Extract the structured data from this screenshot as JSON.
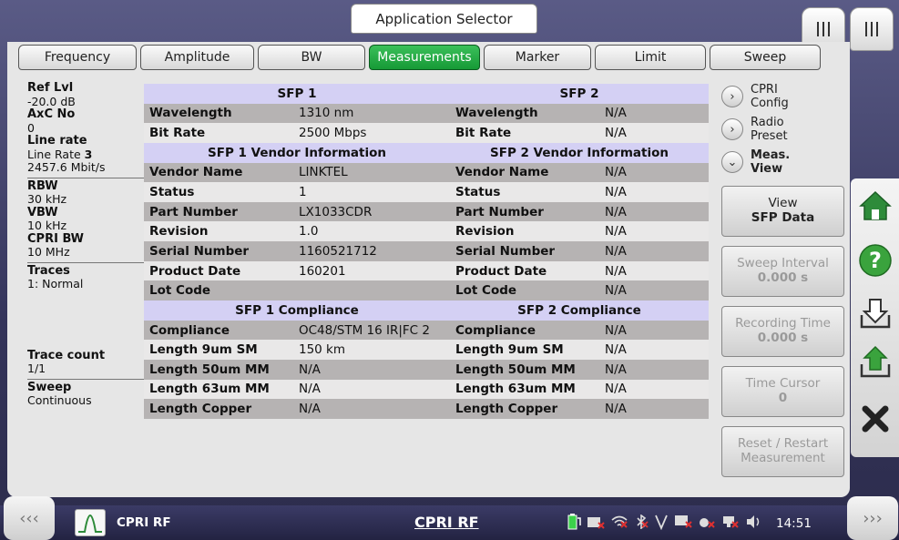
{
  "window": {
    "title": "Application Selector"
  },
  "tabs": [
    {
      "label": "Frequency",
      "active": false
    },
    {
      "label": "Amplitude",
      "active": false
    },
    {
      "label": "BW",
      "active": false
    },
    {
      "label": "Measurements",
      "active": true
    },
    {
      "label": "Marker",
      "active": false
    },
    {
      "label": "Limit",
      "active": false
    },
    {
      "label": "Sweep",
      "active": false
    }
  ],
  "info": {
    "ref_lvl_label": "Ref Lvl",
    "ref_lvl_value": "-20.0 dB",
    "axc_label": "AxC No",
    "axc_value": "0",
    "line_rate_label": "Line rate",
    "line_rate_prefix": "Line Rate ",
    "line_rate_num": "3",
    "line_rate_speed": "2457.6 Mbit/s",
    "rbw_label": "RBW",
    "rbw_value": "30 kHz",
    "vbw_label": "VBW",
    "vbw_value": "10 kHz",
    "cpri_bw_label": "CPRI BW",
    "cpri_bw_value": "10 MHz",
    "traces_label": "Traces",
    "traces_value": "1: Normal",
    "trace_count_label": "Trace count",
    "trace_count_value": "1/1",
    "sweep_label": "Sweep",
    "sweep_value": "Continuous"
  },
  "table": {
    "header1": {
      "sfp1": "SFP 1",
      "sfp2": "SFP 2"
    },
    "rows1": [
      {
        "label": "Wavelength",
        "v1": "1310 nm",
        "label2": "Wavelength",
        "v2": "N/A"
      },
      {
        "label": "Bit Rate",
        "v1": "2500 Mbps",
        "label2": "Bit Rate",
        "v2": "N/A"
      }
    ],
    "header2": {
      "sfp1": "SFP 1 Vendor Information",
      "sfp2": "SFP 2 Vendor Information"
    },
    "rows2": [
      {
        "label": "Vendor Name",
        "v1": "LINKTEL",
        "label2": "Vendor Name",
        "v2": "N/A"
      },
      {
        "label": "Status",
        "v1": "1",
        "label2": "Status",
        "v2": "N/A"
      },
      {
        "label": "Part Number",
        "v1": "LX1033CDR",
        "label2": "Part Number",
        "v2": "N/A"
      },
      {
        "label": "Revision",
        "v1": "1.0",
        "label2": "Revision",
        "v2": "N/A"
      },
      {
        "label": "Serial Number",
        "v1": "1160521712",
        "label2": "Serial Number",
        "v2": "N/A"
      },
      {
        "label": "Product Date",
        "v1": "160201",
        "label2": "Product Date",
        "v2": "N/A"
      },
      {
        "label": "Lot Code",
        "v1": "",
        "label2": "Lot Code",
        "v2": "N/A"
      }
    ],
    "header3": {
      "sfp1": "SFP 1 Compliance",
      "sfp2": "SFP 2 Compliance"
    },
    "rows3": [
      {
        "label": "Compliance",
        "v1": "OC48/STM 16 IR|FC 2",
        "label2": "Compliance",
        "v2": "N/A"
      },
      {
        "label": "Length 9um SM",
        "v1": "150 km",
        "label2": "Length 9um SM",
        "v2": "N/A"
      },
      {
        "label": "Length 50um MM",
        "v1": "N/A",
        "label2": "Length 50um MM",
        "v2": "N/A"
      },
      {
        "label": "Length 63um MM",
        "v1": "N/A",
        "label2": "Length 63um MM",
        "v2": "N/A"
      },
      {
        "label": "Length Copper",
        "v1": "N/A",
        "label2": "Length Copper",
        "v2": "N/A"
      }
    ]
  },
  "right_panel": {
    "cpri_config_l1": "CPRI",
    "cpri_config_l2": "Config",
    "radio_preset_l1": "Radio",
    "radio_preset_l2": "Preset",
    "meas_view_l1": "Meas.",
    "meas_view_l2": "View",
    "view_btn_l1": "View",
    "view_btn_l2": "SFP Data",
    "sweep_interval_l1": "Sweep Interval",
    "sweep_interval_l2": "0.000 s",
    "recording_time_l1": "Recording Time",
    "recording_time_l2": "0.000 s",
    "time_cursor_l1": "Time Cursor",
    "time_cursor_l2": "0",
    "reset_l1": "Reset / Restart",
    "reset_l2": "Measurement"
  },
  "bottom_bar": {
    "app_label": "CPRI RF",
    "center_label": "CPRI RF",
    "clock": "14:51"
  },
  "colors": {
    "active_tab": "#169a36",
    "header_row": "#d4d0f4",
    "dark_row": "#b6b3b3",
    "light_row": "#e9e8e8",
    "home_icon": "#2e8b3a",
    "help_icon": "#3aa33d"
  }
}
